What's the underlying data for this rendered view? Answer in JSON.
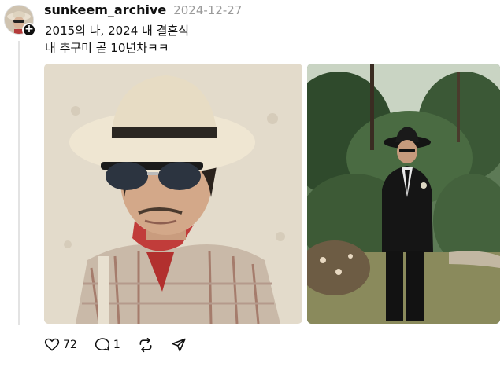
{
  "post": {
    "username": "sunkeem_archive",
    "timestamp": "2024-12-27",
    "text_line1": "2015의 나, 2024 내 결혼식",
    "text_line2": "내 추구미 곧 10년차ㅋㅋ"
  },
  "actions": {
    "like_count": "72",
    "reply_count": "1",
    "icons": [
      "heart-icon",
      "comment-icon",
      "repost-icon",
      "share-icon"
    ]
  },
  "colors": {
    "text": "#101010",
    "muted": "#9a9a9a",
    "thread_line": "#e3e3e3"
  }
}
